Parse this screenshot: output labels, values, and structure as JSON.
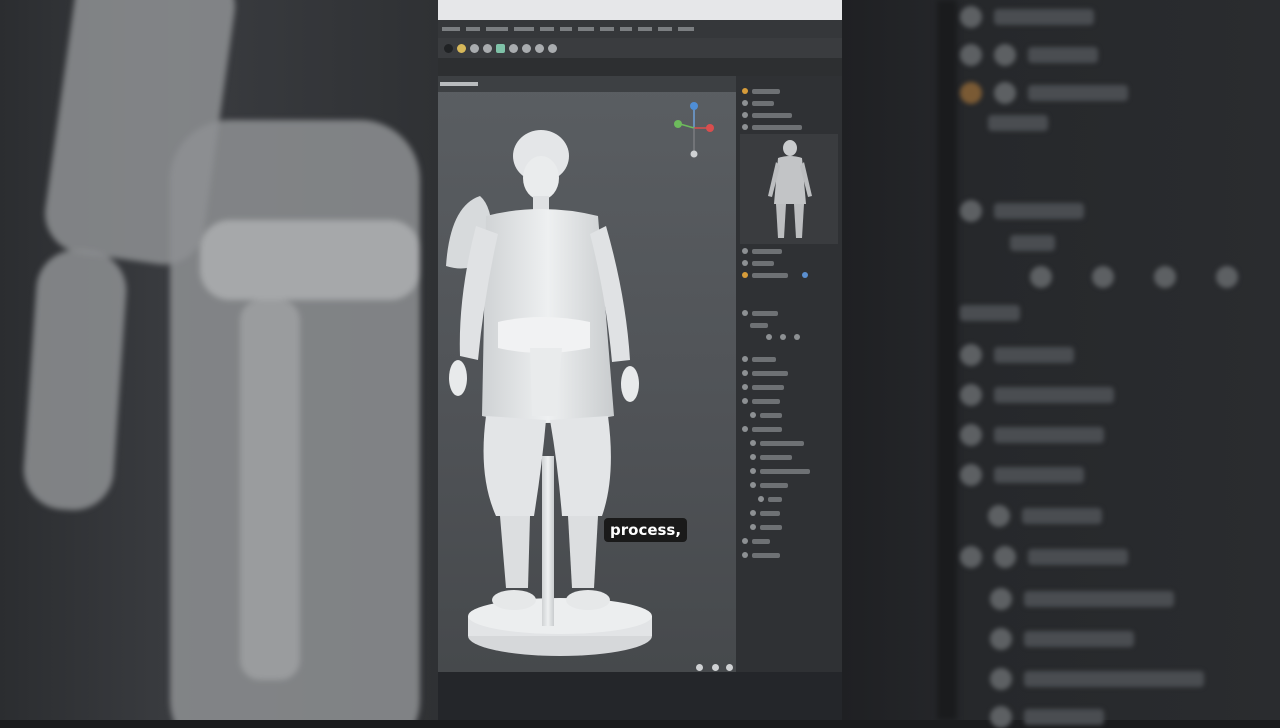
{
  "caption": "process,",
  "colors": {
    "background": "#1b1c1e",
    "viewport_bg": "#51555a",
    "sculpt": "#e7e9eb",
    "caption_bg": "#1a1a1a"
  },
  "icons": [
    "axis-gizmo-icon",
    "toolbar-icons",
    "character-sculpt",
    "thumbnail-figure"
  ]
}
